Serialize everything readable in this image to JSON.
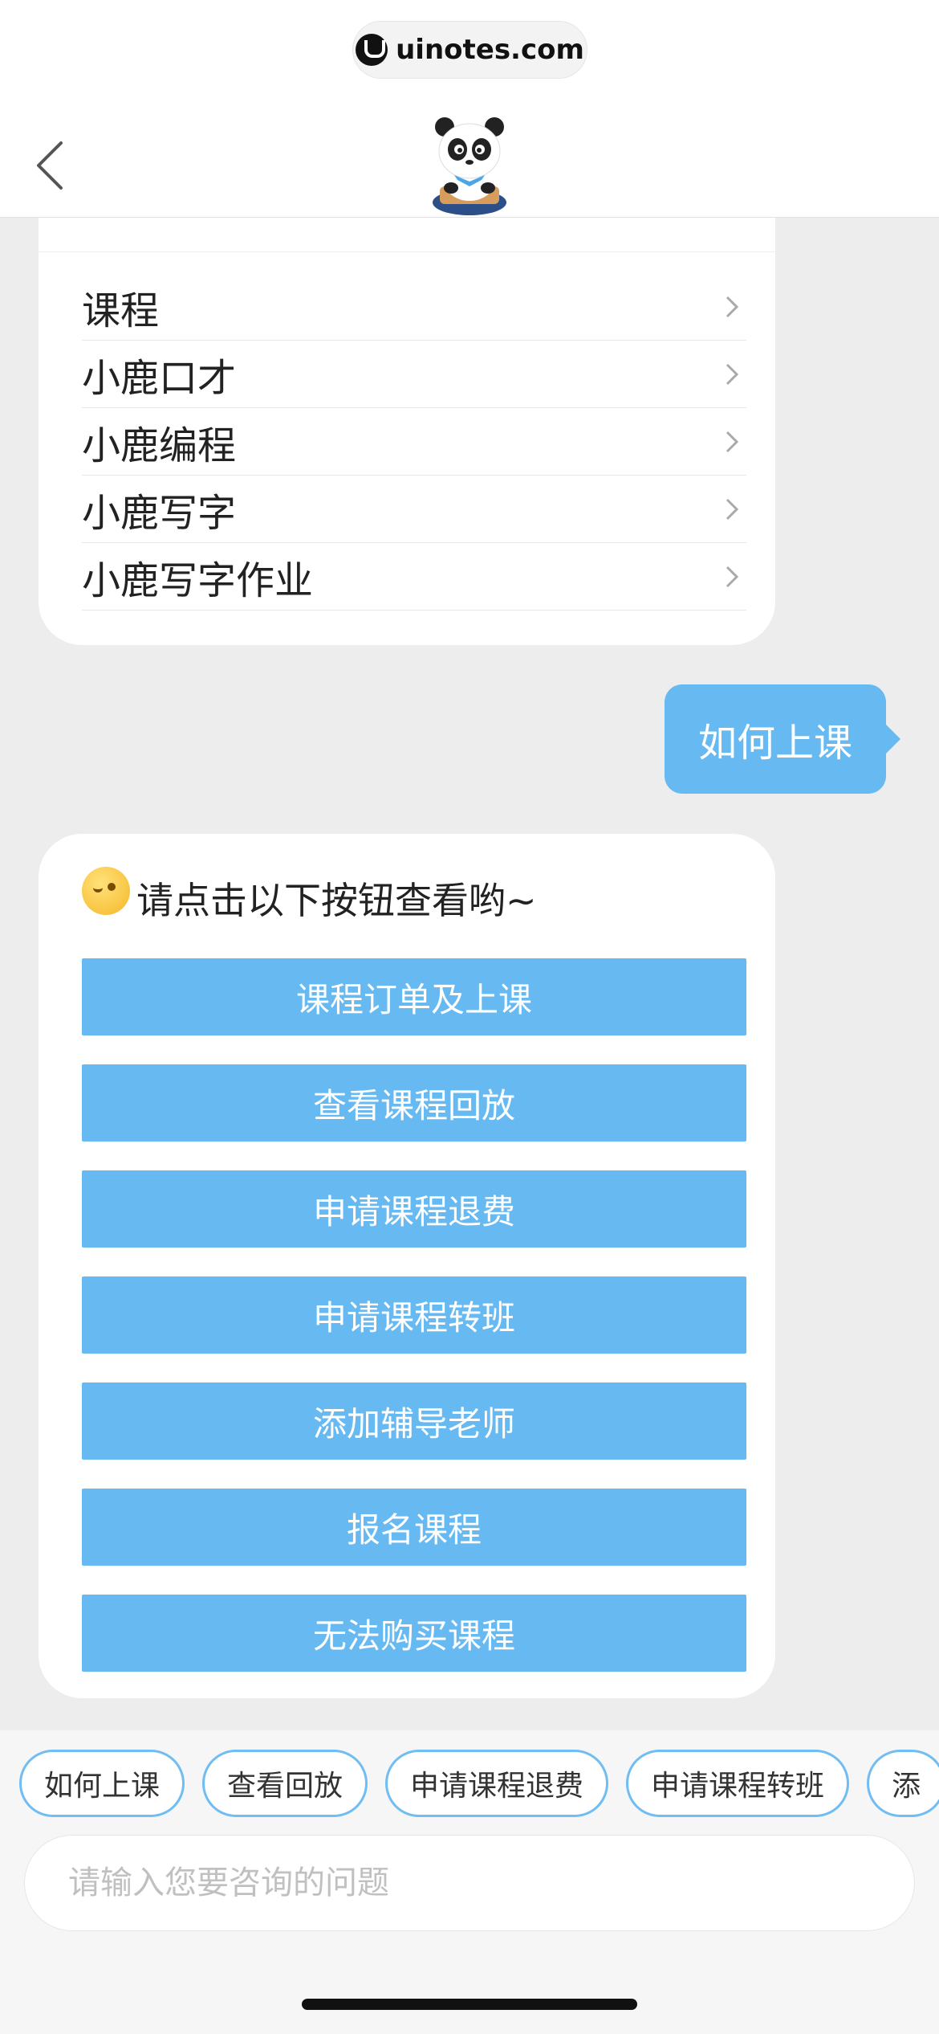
{
  "header": {
    "watermark": "uinotes.com"
  },
  "menu": {
    "items": [
      {
        "label": "课程"
      },
      {
        "label": "小鹿口才"
      },
      {
        "label": "小鹿编程"
      },
      {
        "label": "小鹿写字"
      },
      {
        "label": "小鹿写字作业"
      }
    ]
  },
  "user_message": "如何上课",
  "reply": {
    "title": "请点击以下按钮查看哟~",
    "buttons": [
      {
        "label": "课程订单及上课"
      },
      {
        "label": "查看课程回放"
      },
      {
        "label": "申请课程退费"
      },
      {
        "label": "申请课程转班"
      },
      {
        "label": "添加辅导老师"
      },
      {
        "label": "报名课程"
      },
      {
        "label": "无法购买课程"
      }
    ]
  },
  "quick_replies": [
    {
      "label": "如何上课"
    },
    {
      "label": "查看回放"
    },
    {
      "label": "申请课程退费"
    },
    {
      "label": "申请课程转班"
    },
    {
      "label": "添"
    }
  ],
  "input": {
    "value": "",
    "placeholder": "请输入您要咨询的问题"
  },
  "colors": {
    "accent": "#67b9f2",
    "background": "#ededed"
  }
}
